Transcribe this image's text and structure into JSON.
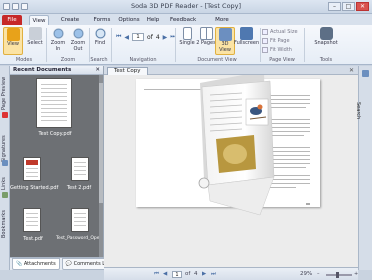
{
  "window": {
    "title": "Soda 3D PDF Reader - [Test Copy]",
    "min": "–",
    "max": "□",
    "close": "✕"
  },
  "tabs": [
    {
      "label": "File"
    },
    {
      "label": "View"
    },
    {
      "label": "Create PDF"
    },
    {
      "label": "Forms"
    },
    {
      "label": "Options"
    },
    {
      "label": "Help"
    },
    {
      "label": "Feedback"
    },
    {
      "label": "More features"
    }
  ],
  "ribbon": {
    "view": "View",
    "select": "Select",
    "zoom_in": "Zoom In",
    "zoom_out": "Zoom Out",
    "find": "Find",
    "page_current": "1",
    "page_of": "of",
    "page_total": "4",
    "single": "Single",
    "two_pages": "2 Pages",
    "view_3d": "3D View",
    "fullscreen": "Fullscreen",
    "actual_size": "Actual Size",
    "fit_page": "Fit Page",
    "fit_width": "Fit Width",
    "snapshot": "Snapshot",
    "groups": {
      "modes": "Modes",
      "zoom": "Zoom",
      "search": "Search",
      "navigation": "Navigation",
      "document_view": "Document View",
      "page_view": "Page View",
      "tools": "Tools"
    }
  },
  "left_strip": {
    "page_preview": "Page Preview",
    "signatures": "Signatures",
    "links": "Links",
    "bookmarks": "Bookmarks"
  },
  "recent_docs": {
    "title": "Recent Documents",
    "close": "✕",
    "items": [
      {
        "name": "Test Copy.pdf"
      },
      {
        "name": "Getting Started.pdf"
      },
      {
        "name": "Test 2.pdf"
      },
      {
        "name": "Test.pdf"
      },
      {
        "name": "Test_Password_Open File"
      }
    ]
  },
  "bottom_tabs": {
    "attachments": "Attachments",
    "comments": "Comments List"
  },
  "doc_tab": {
    "label": "Test Copy",
    "close": "✕"
  },
  "right_strip": {
    "search": "Search"
  },
  "status": {
    "page_current": "1",
    "page_of": "of",
    "page_total": "4",
    "zoom": "29%"
  }
}
